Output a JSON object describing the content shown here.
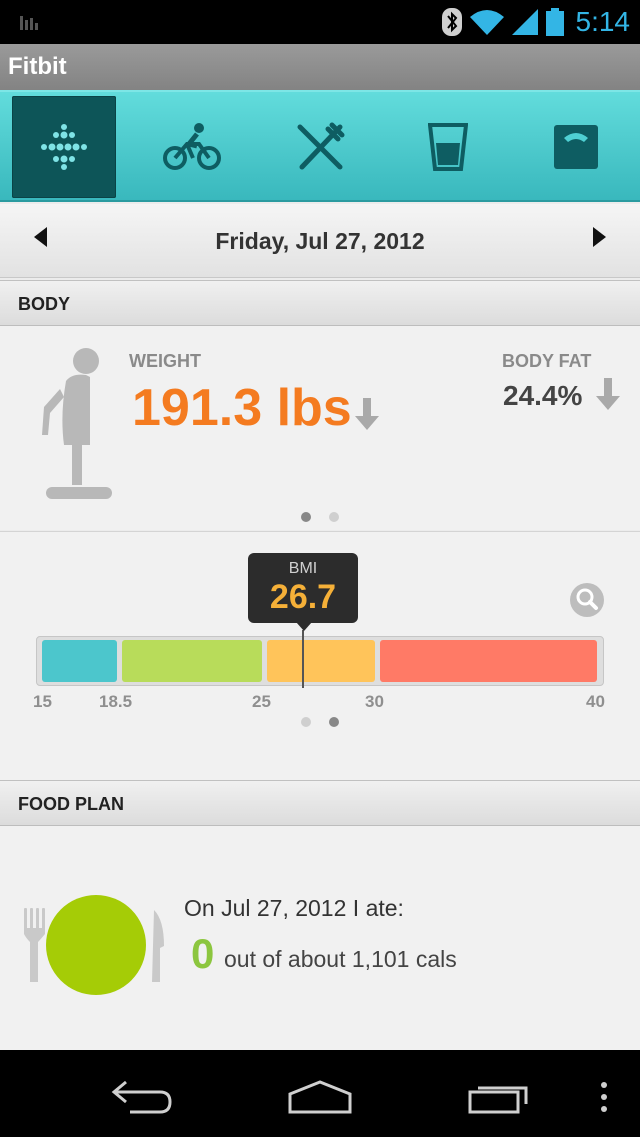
{
  "status_bar": {
    "time": "5:14",
    "icons": [
      "notification-bars-icon",
      "bluetooth-icon",
      "wifi-icon",
      "cell-signal-icon",
      "battery-icon"
    ]
  },
  "app": {
    "title": "Fitbit"
  },
  "tabs": [
    {
      "name": "dashboard",
      "icon": "fitbit-dots-icon",
      "active": true
    },
    {
      "name": "activity",
      "icon": "bicycle-icon",
      "active": false
    },
    {
      "name": "food",
      "icon": "fork-knife-icon",
      "active": false
    },
    {
      "name": "water",
      "icon": "glass-icon",
      "active": false
    },
    {
      "name": "weight",
      "icon": "scale-icon",
      "active": false
    }
  ],
  "date_nav": {
    "date": "Friday, Jul 27, 2012"
  },
  "body_section": {
    "header": "BODY",
    "weight_label": "WEIGHT",
    "weight_value": "191.3 lbs",
    "body_fat_label": "BODY FAT",
    "body_fat_value": "24.4%",
    "page_indicator": {
      "pages": 2,
      "current": 1
    }
  },
  "bmi": {
    "label": "BMI",
    "value": "26.7",
    "ticks": [
      "15",
      "18.5",
      "25",
      "30",
      "40"
    ],
    "segments_colors": [
      "#4cc6cc",
      "#b8dc5a",
      "#ffc45a",
      "#ff7a66"
    ],
    "page_indicator": {
      "pages": 2,
      "current": 2
    }
  },
  "food_section": {
    "header": "FOOD PLAN",
    "intro": "On Jul 27, 2012 I ate:",
    "eaten": "0",
    "summary": "out of about 1,101 cals"
  },
  "colors": {
    "accent_teal": "#4fd0d3",
    "weight_orange": "#f47b20",
    "food_green": "#a5cc06",
    "status_blue": "#33b5e5"
  }
}
